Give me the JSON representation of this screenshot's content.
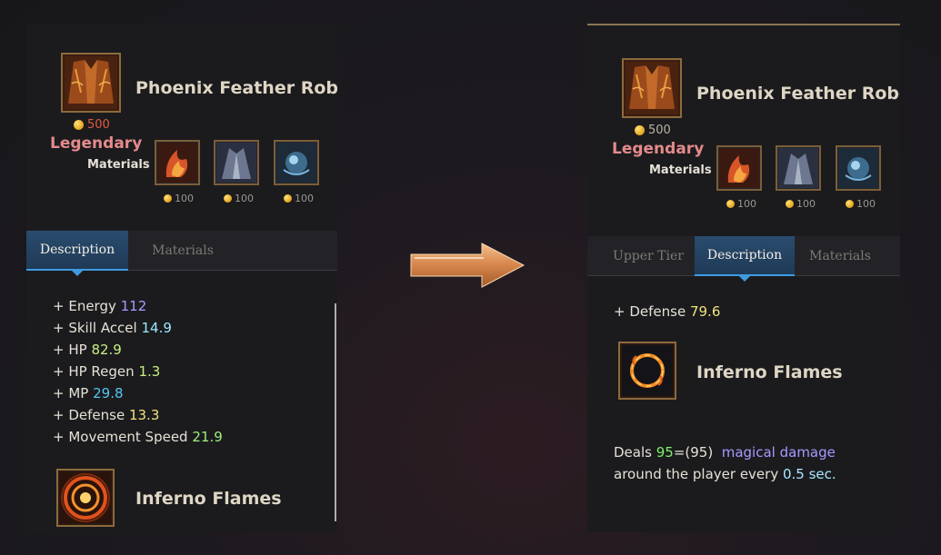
{
  "left_panel": {
    "item_name": "Phoenix Feather Robe",
    "price": "500",
    "rarity": "Legendary",
    "materials_label": "Materials",
    "materials": [
      {
        "name": "flame-feather-material-icon",
        "cost": "100"
      },
      {
        "name": "robe-material-icon",
        "cost": "100"
      },
      {
        "name": "orb-material-icon",
        "cost": "100"
      }
    ],
    "tabs": [
      {
        "label": "Description",
        "active": true
      },
      {
        "label": "Materials",
        "active": false
      }
    ],
    "stats": [
      {
        "label": "+ Energy",
        "value": "112",
        "color": "#a69bff"
      },
      {
        "label": "+ Skill Accel",
        "value": "14.9",
        "color": "#9ee8ff"
      },
      {
        "label": "+ HP",
        "value": "82.9",
        "color": "#c7ef7f"
      },
      {
        "label": "+ HP Regen",
        "value": "1.3",
        "color": "#c7ef7f"
      },
      {
        "label": "+ MP",
        "value": "29.8",
        "color": "#54c6f0"
      },
      {
        "label": "+ Defense",
        "value": "13.3",
        "color": "#f1e27c"
      },
      {
        "label": "+ Movement Speed",
        "value": "21.9",
        "color": "#9ef07a"
      }
    ],
    "skill_name": "Inferno Flames"
  },
  "right_panel": {
    "item_name": "Phoenix Feather Robe",
    "price": "500",
    "rarity": "Legendary",
    "materials_label": "Materials",
    "materials": [
      {
        "name": "flame-feather-material-icon",
        "cost": "100"
      },
      {
        "name": "robe-material-icon",
        "cost": "100"
      },
      {
        "name": "orb-material-icon",
        "cost": "100"
      }
    ],
    "tabs": [
      {
        "label": "Upper Tier",
        "active": false
      },
      {
        "label": "Description",
        "active": true
      },
      {
        "label": "Materials",
        "active": false
      }
    ],
    "stat": {
      "label": "+ Defense",
      "value": "79.6",
      "color": "#f1e27c"
    },
    "skill_name": "Inferno Flames",
    "skill_desc": {
      "deals": "Deals",
      "amount": "95",
      "formula": "=(95)",
      "damage_type": "magical damage",
      "line2_pre": "around the player every",
      "interval": "0.5 sec."
    }
  },
  "colors": {
    "legendary": "#e48a8a",
    "price": "#e25a3c",
    "tab_active": "#2a4c6e",
    "tab_indicator": "#3f9be0"
  }
}
